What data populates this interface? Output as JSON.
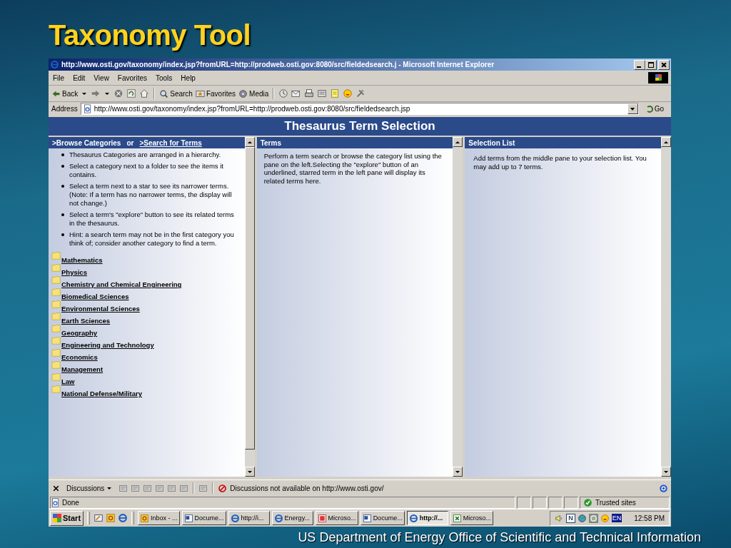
{
  "slide": {
    "title": "Taxonomy Tool",
    "footer": "US Department of Energy Office of Scientific and Technical Information"
  },
  "window": {
    "title": "http://www.osti.gov/taxonomy/index.jsp?fromURL=http://prodweb.osti.gov:8080/src/fieldedsearch.j - Microsoft Internet Explorer"
  },
  "menu": [
    "File",
    "Edit",
    "View",
    "Favorites",
    "Tools",
    "Help"
  ],
  "toolbar": [
    {
      "kind": "back",
      "label": "Back"
    },
    {
      "kind": "forward"
    },
    {
      "kind": "stop"
    },
    {
      "kind": "refresh"
    },
    {
      "kind": "home"
    },
    {
      "kind": "search",
      "label": "Search"
    },
    {
      "kind": "favorites",
      "label": "Favorites"
    },
    {
      "kind": "media",
      "label": "Media"
    },
    {
      "kind": "history"
    },
    {
      "kind": "mail"
    },
    {
      "kind": "print"
    },
    {
      "kind": "edit"
    },
    {
      "kind": "note"
    },
    {
      "kind": "smiley"
    },
    {
      "kind": "tool"
    }
  ],
  "address": {
    "label": "Address",
    "value": "http://www.osti.gov/taxonomy/index.jsp?fromURL=http://prodweb.osti.gov:8080/src/fieldedsearch.jsp",
    "go": "Go"
  },
  "page": {
    "heading": "Thesaurus Term Selection",
    "left": {
      "link_browse": ">Browse Categories",
      "separator": "or",
      "link_search": ">Search for Terms",
      "bullets": [
        "Thesaurus Categories are arranged in a hierarchy.",
        "Select a category next to a folder to see the items it contains.",
        "Select a term next to a star to see its narrower terms. (Note: If a term has no narrower terms, the display will not change.)",
        "Select a term's \"explore\" button to see its related terms in the thesaurus.",
        "Hint: a search term may not be in the first category you think of; consider another category to find a term."
      ],
      "categories": [
        "Mathematics",
        "Physics",
        "Chemistry and Chemical Engineering",
        "Biomedical Sciences",
        "Environmental Sciences",
        "Earth Sciences",
        "Geography",
        "Engineering and Technology",
        "Economics",
        "Management",
        "Law",
        "National Defense/Military"
      ]
    },
    "middle": {
      "title": "Terms",
      "text": "Perform a term search or browse the category list using the pane on the left.Selecting the \"explore\" button of an underlined, starred term in the left pane will display its related terms here."
    },
    "right": {
      "title": "Selection List",
      "text": "Add terms from the middle pane to your selection list. You may add up to 7 terms."
    }
  },
  "discussions": {
    "label": "Discussions",
    "message": "Discussions not available on http://www.osti.gov/"
  },
  "status_bar": {
    "text": "Done",
    "zone": "Trusted sites"
  },
  "taskbar": {
    "start": "Start",
    "quick_launch": [
      {
        "kind": "desktop"
      },
      {
        "kind": "outlook"
      },
      {
        "kind": "ie"
      }
    ],
    "tasks": [
      {
        "kind": "outlook",
        "label": "Inbox - ...",
        "selected": false
      },
      {
        "kind": "word",
        "label": "Docume...",
        "selected": false
      },
      {
        "kind": "ie",
        "label": "http://i...",
        "selected": false
      },
      {
        "kind": "ie",
        "label": "Energy...",
        "selected": false
      },
      {
        "kind": "pdf",
        "label": "Microso...",
        "selected": false
      },
      {
        "kind": "word",
        "label": "Docume...",
        "selected": false
      },
      {
        "kind": "ie",
        "label": "http://...",
        "selected": true
      },
      {
        "kind": "excel",
        "label": "Microso...",
        "selected": false
      }
    ],
    "tray": [
      {
        "kind": "volume"
      },
      {
        "kind": "letter",
        "label": "N"
      },
      {
        "kind": "globe"
      },
      {
        "kind": "clock"
      },
      {
        "kind": "smiley"
      },
      {
        "kind": "language",
        "label": "EN"
      }
    ],
    "clock": "12:58 PM"
  }
}
